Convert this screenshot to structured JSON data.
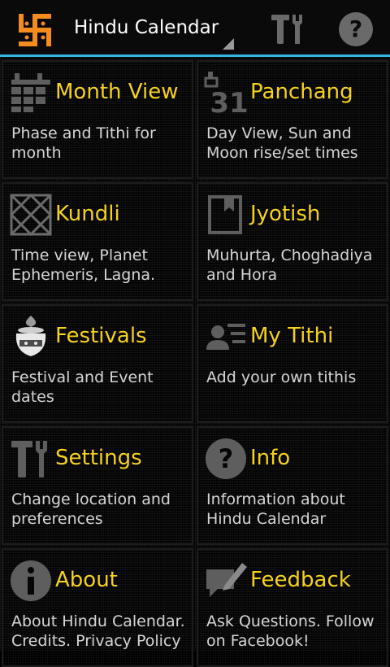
{
  "action_bar": {
    "title": "Hindu Calendar",
    "icons": [
      "swastika-icon",
      "tools-icon",
      "help-icon"
    ],
    "brand_color": "#f58b1f",
    "accent_color": "#33b5e5"
  },
  "tiles": [
    {
      "name": "Month View",
      "desc": "Phase and Tithi for month",
      "icon": "calendar-grid-icon"
    },
    {
      "name": "Panchang",
      "desc": "Day View, Sun and Moon rise/set times",
      "icon": "calendar-31-icon"
    },
    {
      "name": "Kundli",
      "desc": "Time view, Planet Ephemeris, Lagna.",
      "icon": "kundli-chart-icon"
    },
    {
      "name": "Jyotish",
      "desc": "Muhurta, Choghadiya and Hora",
      "icon": "book-bookmark-icon"
    },
    {
      "name": "Festivals",
      "desc": "Festival and Event dates",
      "icon": "kalash-icon"
    },
    {
      "name": "My Tithi",
      "desc": "Add your own tithis",
      "icon": "person-list-icon"
    },
    {
      "name": "Settings",
      "desc": "Change location and preferences",
      "icon": "tools-icon"
    },
    {
      "name": "Info",
      "desc": "Information about Hindu Calendar",
      "icon": "question-icon"
    },
    {
      "name": "About",
      "desc": "About Hindu Calendar. Credits. Privacy Policy",
      "icon": "info-icon"
    },
    {
      "name": "Feedback",
      "desc": "Ask Questions. Follow on Facebook!",
      "icon": "feedback-pen-icon"
    }
  ],
  "colors": {
    "tile_title": "#f7d21c",
    "tile_desc": "#d6d6d6",
    "icon_gray": "#5e5e5e"
  }
}
